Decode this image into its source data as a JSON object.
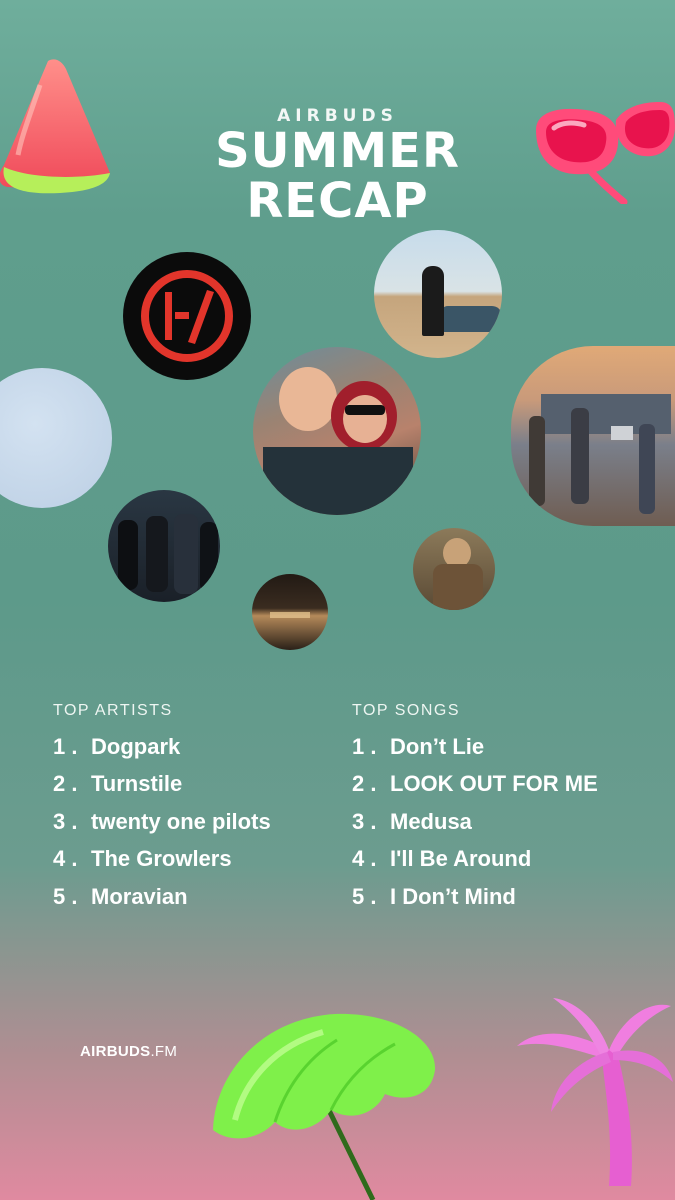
{
  "header": {
    "brand": "AIRBUDS",
    "title_line1": "SUMMER",
    "title_line2": "RECAP"
  },
  "artwork": [
    {
      "name": "top-pilots-logo-art"
    },
    {
      "name": "desert-car-art"
    },
    {
      "name": "light-blue-blank-art"
    },
    {
      "name": "friends-selfie-art"
    },
    {
      "name": "city-rooftop-band-art"
    },
    {
      "name": "band-portrait-dark-art"
    },
    {
      "name": "subway-portrait-art"
    },
    {
      "name": "beach-sunset-art"
    }
  ],
  "top_artists": {
    "heading": "TOP ARTISTS",
    "items": [
      {
        "rank": "1 .",
        "name": "Dogpark"
      },
      {
        "rank": "2 .",
        "name": "Turnstile"
      },
      {
        "rank": "3 .",
        "name": "twenty one pilots"
      },
      {
        "rank": "4 .",
        "name": "The Growlers"
      },
      {
        "rank": "5 .",
        "name": "Moravian"
      }
    ]
  },
  "top_songs": {
    "heading": "TOP SONGS",
    "items": [
      {
        "rank": "1 .",
        "name": "Don’t Lie"
      },
      {
        "rank": "2 .",
        "name": "LOOK OUT FOR ME"
      },
      {
        "rank": "3 .",
        "name": "Medusa"
      },
      {
        "rank": "4 .",
        "name": "I'll Be Around"
      },
      {
        "rank": "5 .",
        "name": "I Don’t Mind"
      }
    ]
  },
  "footer": {
    "logo_main": "AIRBUDS",
    "logo_suffix": ".FM"
  },
  "colors": {
    "background_top": "#6fae9c",
    "background_bottom": "#e08aa0",
    "text": "#ffffff"
  },
  "decorations": [
    "watermelon-icon",
    "sunglasses-icon",
    "beach-umbrella-icon",
    "palm-tree-icon"
  ]
}
